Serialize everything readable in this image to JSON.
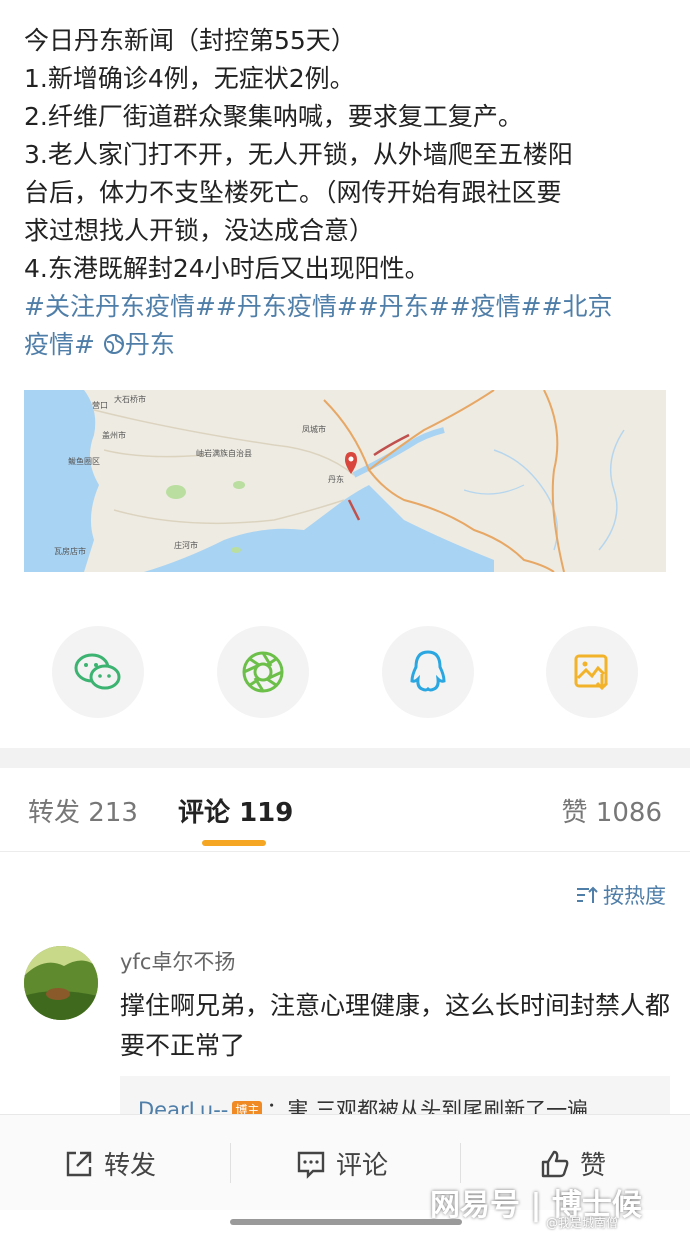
{
  "post": {
    "lines": [
      "今日丹东新闻（封控第55天）",
      "1.新增确诊4例，无症状2例。",
      "2.纤维厂街道群众聚集呐喊，要求复工复产。",
      "3.老人家门打不开，无人开锁，从外墙爬至五楼阳",
      "台后，体力不支坠楼死亡。（网传开始有跟社区要",
      "求过想找人开锁，没达成合意）",
      "4.东港既解封24小时后又出现阳性。"
    ],
    "tags_line1": "#关注丹东疫情##丹东疫情##丹东##疫情##北京",
    "tags_line2": "疫情#",
    "location": "丹东"
  },
  "map": {
    "labels": {
      "yingkou": "营口",
      "dashiqiao": "大石桥市",
      "gaizhou": "盖州市",
      "bayuquan": "鲅鱼圈区",
      "xiuyan": "岫岩满族自治县",
      "fengcheng": "凤城市",
      "dandong": "丹东",
      "zhuanghe": "庄河市",
      "wafangdian": "瓦房店市"
    },
    "colors": {
      "land": "#eeebe2",
      "sea": "#a9d3f2",
      "border": "#e7a765",
      "route": "#c0504d",
      "pin": "#d9463d"
    }
  },
  "share": {
    "buttons": [
      {
        "name": "wechat",
        "icon": "wechat-icon",
        "color": "#3cb371"
      },
      {
        "name": "moments",
        "icon": "moments-icon",
        "color": "#6cc04a"
      },
      {
        "name": "qq",
        "icon": "qq-icon",
        "color": "#2aa6e0"
      },
      {
        "name": "save-image",
        "icon": "save-image-icon",
        "color": "#f2b32a"
      }
    ]
  },
  "tabs": {
    "repost_label": "转发",
    "repost_count": "213",
    "comment_label": "评论",
    "comment_count": "119",
    "like_label": "赞",
    "like_count": "1086"
  },
  "sort": {
    "label": "按热度"
  },
  "comment": {
    "user": "yfc卓尔不扬",
    "text": "撑住啊兄弟，注意心理健康，这么长时间封禁人都要不正常了",
    "reply": {
      "user": "DearLu--",
      "badge": "博主",
      "text": "：害 三观都被从头到尾刷新了一遍"
    }
  },
  "bottom_bar": {
    "repost": "转发",
    "comment": "评论",
    "like": "赞"
  },
  "watermark": {
    "main": "网易号 | 博士候",
    "sub": "@我是城南僧"
  }
}
